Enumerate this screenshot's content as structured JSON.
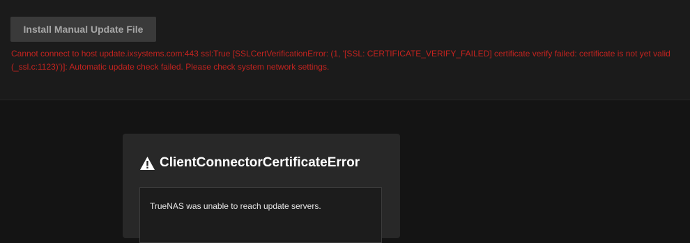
{
  "update": {
    "install_button_label": "Install Manual Update File",
    "error_message": "Cannot connect to host update.ixsystems.com:443 ssl:True [SSLCertVerificationError: (1, '[SSL: CERTIFICATE_VERIFY_FAILED] certificate verify failed: certificate is not yet valid (_ssl.c:1123)')]: Automatic update check failed. Please check system network settings."
  },
  "dialog": {
    "icon": "warning-icon",
    "title": "ClientConnectorCertificateError",
    "message": "TrueNAS was unable to reach update servers."
  },
  "colors": {
    "error_text": "#c4231f",
    "button_bg": "#3a3a3a",
    "panel_bg": "#1b1b1b",
    "dialog_bg": "#282828"
  }
}
